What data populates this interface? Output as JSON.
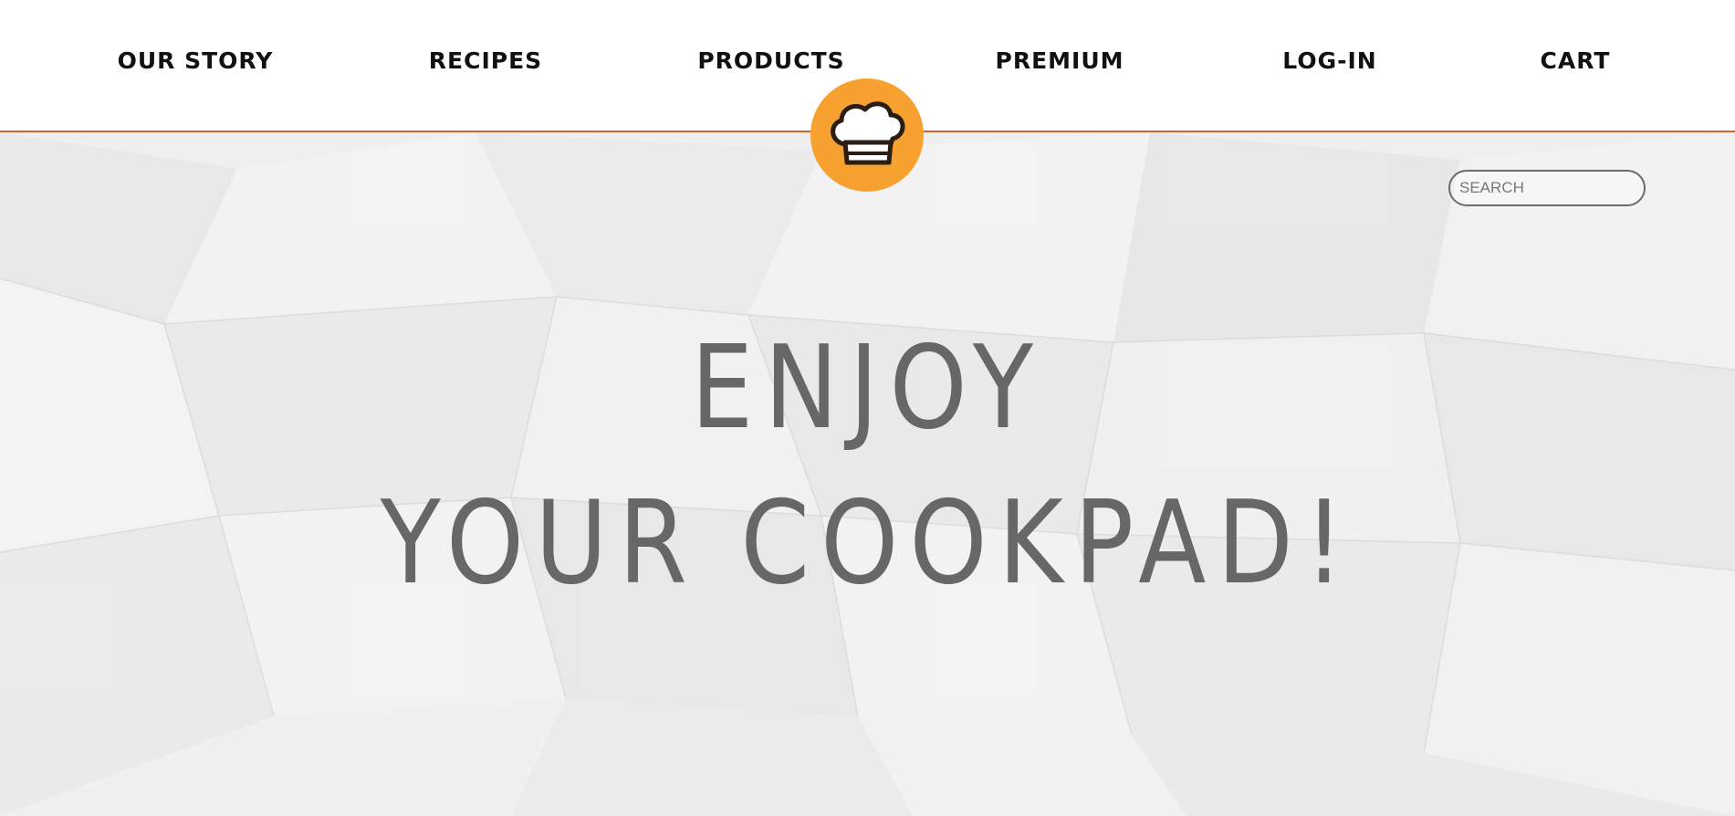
{
  "nav": {
    "items": [
      {
        "label": "OUR STORY"
      },
      {
        "label": "RECIPES"
      },
      {
        "label": "PRODUCTS"
      },
      {
        "label": "PREMIUM"
      },
      {
        "label": "LOG-IN"
      },
      {
        "label": "CART"
      }
    ]
  },
  "logo": {
    "icon": "chef-hat-icon",
    "background_color": "#f7a130"
  },
  "search": {
    "placeholder": "SEARCH",
    "value": ""
  },
  "hero": {
    "line1": "ENJOY",
    "line2": "YOUR COOKPAD!"
  },
  "colors": {
    "accent_line": "#d2642c",
    "title_text": "#676767"
  }
}
